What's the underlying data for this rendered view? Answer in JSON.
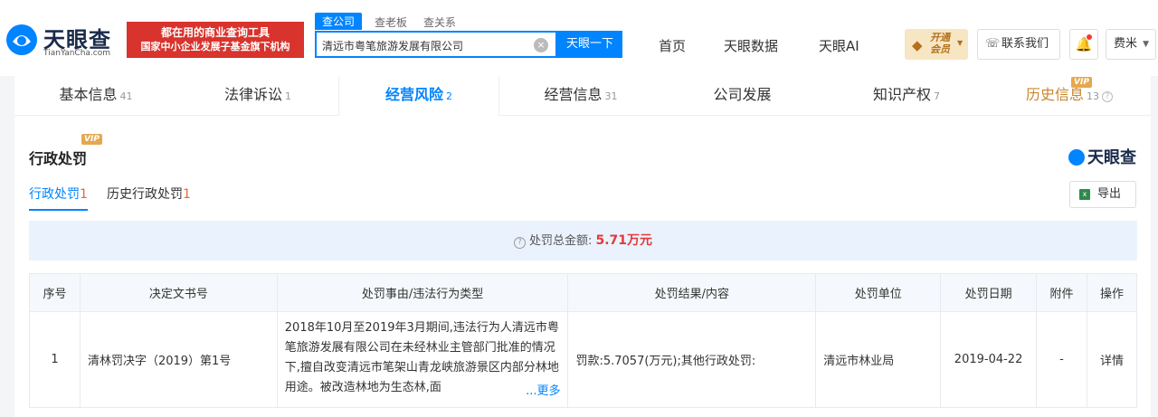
{
  "header": {
    "logo_text": "天眼查",
    "logo_sub": "TianYanCha.com",
    "badge_line1": "都在用的商业查询工具",
    "badge_line2": "国家中小企业发展子基金旗下机构",
    "search_tabs": [
      "查公司",
      "查老板",
      "查关系"
    ],
    "search_value": "清远市粤笔旅游发展有限公司",
    "search_button": "天眼一下",
    "nav": [
      "首页",
      "天眼数据",
      "天眼AI"
    ],
    "vip_line1": "开通",
    "vip_line2": "会员",
    "contact": "联系我们",
    "user": "费米"
  },
  "tabs": [
    {
      "label": "基本信息",
      "count": "41"
    },
    {
      "label": "法律诉讼",
      "count": "1"
    },
    {
      "label": "经营风险",
      "count": "2"
    },
    {
      "label": "经营信息",
      "count": "31"
    },
    {
      "label": "公司发展",
      "count": ""
    },
    {
      "label": "知识产权",
      "count": "7"
    },
    {
      "label": "历史信息",
      "count": "13"
    }
  ],
  "vip_tag": "VIP",
  "section": {
    "title": "行政处罚",
    "brand": "天眼查",
    "subtabs": [
      {
        "label": "行政处罚",
        "count": "1"
      },
      {
        "label": "历史行政处罚",
        "count": "1"
      }
    ],
    "export": "导出",
    "summary_label": "处罚总金额:",
    "summary_amount": "5.71万元"
  },
  "table": {
    "headers": [
      "序号",
      "决定文书号",
      "处罚事由/违法行为类型",
      "处罚结果/内容",
      "处罚单位",
      "处罚日期",
      "附件",
      "操作"
    ],
    "rows": [
      {
        "index": "1",
        "doc_no": "清林罚决字（2019）第1号",
        "reason": "2018年10月至2019年3月期间,违法行为人清远市粤笔旅游发展有限公司在未经林业主管部门批准的情况下,擅自改变清远市笔架山青龙峡旅游景区内部分林地用途。被改造林地为生态林,面",
        "more": "...更多",
        "result": "罚款:5.7057(万元);其他行政处罚:",
        "unit": "清远市林业局",
        "date": "2019-04-22",
        "attachment": "-",
        "action": "详情"
      }
    ]
  },
  "colors": {
    "accent": "#0084ff",
    "red": "#e4393c",
    "vip": "#c8862c"
  }
}
